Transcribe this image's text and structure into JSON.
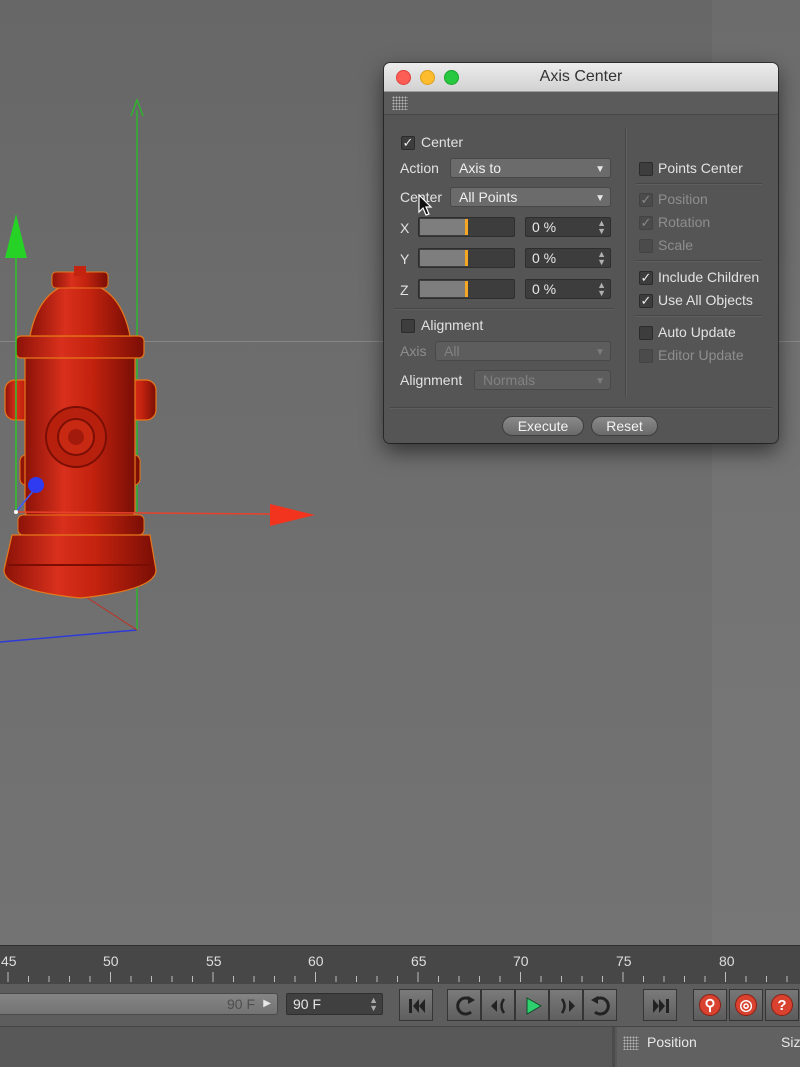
{
  "dialog": {
    "title": "Axis Center",
    "center_checkbox": {
      "label": "Center",
      "checked": true
    },
    "action": {
      "label": "Action",
      "value": "Axis to"
    },
    "center_mode": {
      "label": "Center",
      "value": "All Points"
    },
    "axes": [
      {
        "label": "X",
        "value": "0 %",
        "slider_fraction": 0.5
      },
      {
        "label": "Y",
        "value": "0 %",
        "slider_fraction": 0.5
      },
      {
        "label": "Z",
        "value": "0 %",
        "slider_fraction": 0.5
      }
    ],
    "alignment_checkbox": {
      "label": "Alignment",
      "checked": false
    },
    "axis_select": {
      "label": "Axis",
      "value": "All",
      "enabled": false
    },
    "alignment_select": {
      "label": "Alignment",
      "value": "Normals",
      "enabled": false
    },
    "right_options": [
      {
        "label": "Points Center",
        "checked": false,
        "enabled": true
      },
      {
        "label": "Position",
        "checked": true,
        "enabled": false
      },
      {
        "label": "Rotation",
        "checked": true,
        "enabled": false
      },
      {
        "label": "Scale",
        "checked": false,
        "enabled": false
      },
      {
        "label": "Include Children",
        "checked": true,
        "enabled": true
      },
      {
        "label": "Use All Objects",
        "checked": true,
        "enabled": true
      },
      {
        "label": "Auto Update",
        "checked": false,
        "enabled": true
      },
      {
        "label": "Editor Update",
        "checked": false,
        "enabled": false
      }
    ],
    "execute_label": "Execute",
    "reset_label": "Reset"
  },
  "timeline": {
    "ruler_labels": [
      "45",
      "50",
      "55",
      "60",
      "65",
      "70",
      "75",
      "80"
    ],
    "range_end": "90 F",
    "current_frame_field": "90 F",
    "transport_buttons": [
      "go-to-start",
      "previous-key",
      "previous-frame",
      "play-forward",
      "next-frame",
      "next-key",
      "go-to-end"
    ],
    "record_buttons": [
      "record-active-objects-icon",
      "autokeying-icon",
      "keyframe-selection-icon"
    ]
  },
  "attributes": {
    "position_label": "Position",
    "size_label": "Siz"
  },
  "colors": {
    "hydrant_red": "#d42a1a",
    "axis_x": "#e8412b",
    "axis_y": "#2bc42b",
    "axis_z": "#2f3bd8",
    "slider_knob": "#f5a623",
    "play_green": "#2fd16f"
  }
}
